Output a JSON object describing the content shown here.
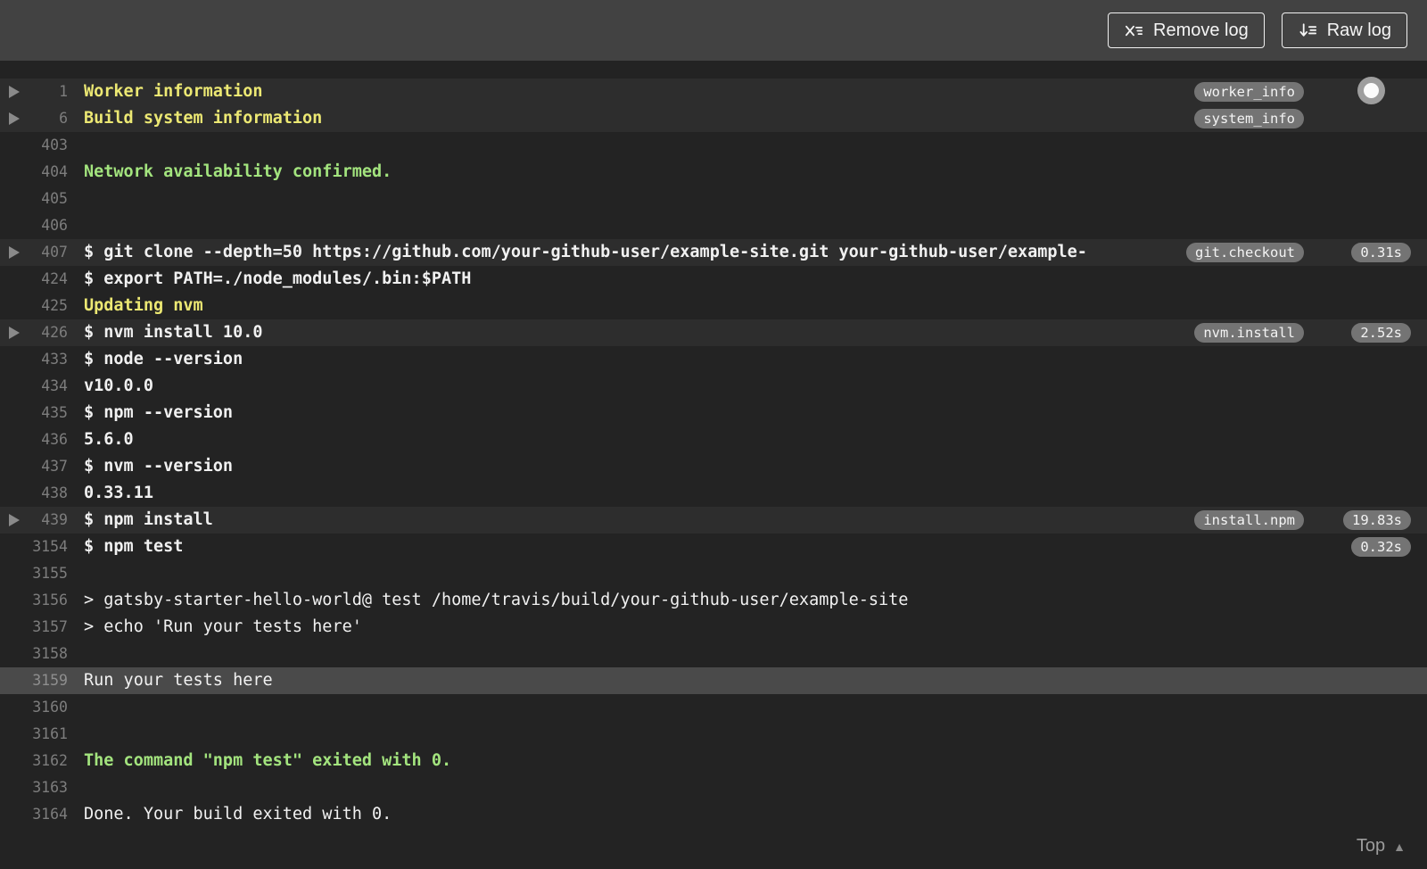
{
  "header": {
    "remove_log_label": "Remove log",
    "raw_log_label": "Raw log"
  },
  "footer": {
    "top_label": "Top"
  },
  "colors": {
    "header_bg": "#424242",
    "log_bg": "#232323",
    "fold_row_bg": "#2d2d2d",
    "selected_row_bg": "#4a4a4a",
    "log_text": "#f1f1f1",
    "yellow": "#ece873",
    "green": "#a3e47e",
    "line_number": "#7d7d7d",
    "badge_bg": "#747474",
    "badge_text": "#f3f3f3"
  },
  "log": {
    "rows": [
      {
        "num": "1",
        "text": "Worker information",
        "color": "yellow",
        "bold": true,
        "fold": true,
        "badge": "worker_info"
      },
      {
        "num": "6",
        "text": "Build system information",
        "color": "yellow",
        "bold": true,
        "fold": true,
        "badge": "system_info"
      },
      {
        "num": "403",
        "text": ""
      },
      {
        "num": "404",
        "text": "Network availability confirmed.",
        "color": "green",
        "bold": true
      },
      {
        "num": "405",
        "text": ""
      },
      {
        "num": "406",
        "text": ""
      },
      {
        "num": "407",
        "text": "$ git clone --depth=50 https://github.com/your-github-user/example-site.git your-github-user/example-",
        "bold": true,
        "fold": true,
        "badge": "git.checkout",
        "time": "0.31s"
      },
      {
        "num": "424",
        "text": "$ export PATH=./node_modules/.bin:$PATH",
        "bold": true
      },
      {
        "num": "425",
        "text": "Updating nvm",
        "color": "yellow",
        "bold": true
      },
      {
        "num": "426",
        "text": "$ nvm install 10.0",
        "bold": true,
        "fold": true,
        "badge": "nvm.install",
        "time": "2.52s"
      },
      {
        "num": "433",
        "text": "$ node --version",
        "bold": true
      },
      {
        "num": "434",
        "text": "v10.0.0",
        "bold": true
      },
      {
        "num": "435",
        "text": "$ npm --version",
        "bold": true
      },
      {
        "num": "436",
        "text": "5.6.0",
        "bold": true
      },
      {
        "num": "437",
        "text": "$ nvm --version",
        "bold": true
      },
      {
        "num": "438",
        "text": "0.33.11",
        "bold": true
      },
      {
        "num": "439",
        "text": "$ npm install",
        "bold": true,
        "fold": true,
        "badge": "install.npm",
        "time": "19.83s"
      },
      {
        "num": "3154",
        "text": "$ npm test",
        "bold": true,
        "time": "0.32s"
      },
      {
        "num": "3155",
        "text": ""
      },
      {
        "num": "3156",
        "text": "> gatsby-starter-hello-world@ test /home/travis/build/your-github-user/example-site"
      },
      {
        "num": "3157",
        "text": "> echo 'Run your tests here'"
      },
      {
        "num": "3158",
        "text": ""
      },
      {
        "num": "3159",
        "text": "Run your tests here",
        "selected": true
      },
      {
        "num": "3160",
        "text": ""
      },
      {
        "num": "3161",
        "text": ""
      },
      {
        "num": "3162",
        "text": "The command \"npm test\" exited with 0.",
        "color": "green",
        "bold": true
      },
      {
        "num": "3163",
        "text": ""
      },
      {
        "num": "3164",
        "text": "Done. Your build exited with 0."
      }
    ]
  }
}
